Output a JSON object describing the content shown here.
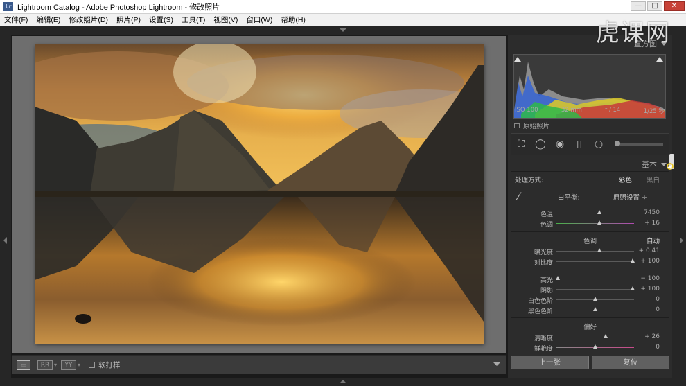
{
  "window": {
    "title": "Lightroom Catalog - Adobe Photoshop Lightroom - 修改照片",
    "app_icon": "Lr",
    "controls": [
      "—",
      "□",
      "✕"
    ]
  },
  "menu": [
    "文件(F)",
    "编辑(E)",
    "修改照片(D)",
    "照片(P)",
    "设置(S)",
    "工具(T)",
    "视图(V)",
    "窗口(W)",
    "帮助(H)"
  ],
  "watermark": "虎课网",
  "toolbar": {
    "view_btn_2": "RR",
    "view_btn_3": "YY",
    "soft_proof_label": "软打样"
  },
  "histogram": {
    "header": "直方图",
    "iso": "ISO 100",
    "focal": "32 mm",
    "aperture": "f / 14",
    "shutter": "1/25 秒",
    "original_photo": "原始照片"
  },
  "basic": {
    "header": "基本",
    "treatment_label": "处理方式:",
    "color": "彩色",
    "bw": "黑白",
    "wb_label": "白平衡:",
    "wb_value": "原照设置 ÷",
    "tone_title": "色调",
    "auto": "自动",
    "presence_title": "偏好"
  },
  "sliders": {
    "temp": {
      "label": "色温",
      "value": "7450",
      "pos": 0.55
    },
    "tint": {
      "label": "色调",
      "value": "+ 16",
      "pos": 0.55
    },
    "exposure": {
      "label": "曝光度",
      "value": "+ 0.41",
      "pos": 0.55
    },
    "contrast": {
      "label": "对比度",
      "value": "+ 100",
      "pos": 0.98
    },
    "highlights": {
      "label": "高光",
      "value": "− 100",
      "pos": 0.02
    },
    "shadows": {
      "label": "阴影",
      "value": "+ 100",
      "pos": 0.98
    },
    "whites": {
      "label": "白色色阶",
      "value": "0",
      "pos": 0.5
    },
    "blacks": {
      "label": "黑色色阶",
      "value": "0",
      "pos": 0.5
    },
    "clarity": {
      "label": "清晰度",
      "value": "+ 26",
      "pos": 0.63
    },
    "vibrance": {
      "label": "鲜艳度",
      "value": "0",
      "pos": 0.5
    }
  },
  "buttons": {
    "previous": "上一张",
    "reset": "复位"
  }
}
